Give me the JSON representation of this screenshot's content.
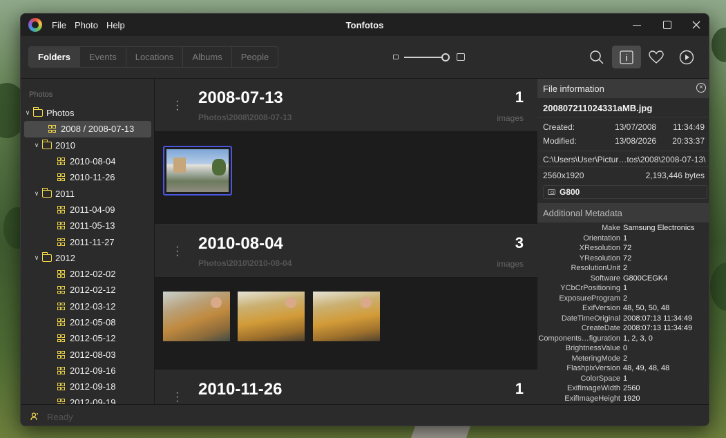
{
  "window": {
    "title": "Tonfotos",
    "menu": [
      "File",
      "Photo",
      "Help"
    ]
  },
  "toolbar": {
    "tabs": [
      "Folders",
      "Events",
      "Locations",
      "Albums",
      "People"
    ],
    "active_tab": "Folders",
    "zoom_level": 0.85
  },
  "sidebar": {
    "header": "Photos",
    "tree": [
      {
        "label": "Photos",
        "depth": 0,
        "type": "folder",
        "expanded": true
      },
      {
        "label": "2008 / 2008-07-13",
        "depth": 1,
        "type": "album",
        "selected": true
      },
      {
        "label": "2010",
        "depth": 1,
        "type": "folder",
        "expanded": true
      },
      {
        "label": "2010-08-04",
        "depth": 2,
        "type": "album"
      },
      {
        "label": "2010-11-26",
        "depth": 2,
        "type": "album"
      },
      {
        "label": "2011",
        "depth": 1,
        "type": "folder",
        "expanded": true
      },
      {
        "label": "2011-04-09",
        "depth": 2,
        "type": "album"
      },
      {
        "label": "2011-05-13",
        "depth": 2,
        "type": "album"
      },
      {
        "label": "2011-11-27",
        "depth": 2,
        "type": "album"
      },
      {
        "label": "2012",
        "depth": 1,
        "type": "folder",
        "expanded": true
      },
      {
        "label": "2012-02-02",
        "depth": 2,
        "type": "album"
      },
      {
        "label": "2012-02-12",
        "depth": 2,
        "type": "album"
      },
      {
        "label": "2012-03-12",
        "depth": 2,
        "type": "album"
      },
      {
        "label": "2012-05-08",
        "depth": 2,
        "type": "album"
      },
      {
        "label": "2012-05-12",
        "depth": 2,
        "type": "album"
      },
      {
        "label": "2012-08-03",
        "depth": 2,
        "type": "album"
      },
      {
        "label": "2012-09-16",
        "depth": 2,
        "type": "album"
      },
      {
        "label": "2012-09-18",
        "depth": 2,
        "type": "album"
      },
      {
        "label": "2012-09-19",
        "depth": 2,
        "type": "album"
      }
    ]
  },
  "main": {
    "groups": [
      {
        "title": "2008-07-13",
        "path": "Photos\\2008\\2008-07-13",
        "count": "1",
        "unit": "images"
      },
      {
        "title": "2010-08-04",
        "path": "Photos\\2010\\2010-08-04",
        "count": "3",
        "unit": "images"
      },
      {
        "title": "2010-11-26",
        "path": "",
        "count": "1",
        "unit": ""
      }
    ]
  },
  "info": {
    "header": "File information",
    "filename": "200807211024331aMB.jpg",
    "created_label": "Created:",
    "created_date": "13/07/2008",
    "created_time": "11:34:49",
    "modified_label": "Modified:",
    "modified_date": "13/08/2026",
    "modified_time": "20:33:37",
    "path": "C:\\Users\\User\\Pictur…tos\\2008\\2008-07-13\\",
    "resolution": "2560x1920",
    "size": "2,193,446 bytes",
    "camera": "G800",
    "meta_header": "Additional Metadata",
    "metadata": [
      {
        "key": "Make",
        "value": "Samsung Electronics"
      },
      {
        "key": "Orientation",
        "value": "1"
      },
      {
        "key": "XResolution",
        "value": "72"
      },
      {
        "key": "YResolution",
        "value": "72"
      },
      {
        "key": "ResolutionUnit",
        "value": "2"
      },
      {
        "key": "Software",
        "value": "G800CEGK4"
      },
      {
        "key": "YCbCrPositioning",
        "value": "1"
      },
      {
        "key": "ExposureProgram",
        "value": "2"
      },
      {
        "key": "ExifVersion",
        "value": "48, 50, 50, 48"
      },
      {
        "key": "DateTimeOriginal",
        "value": "2008:07:13 11:34:49"
      },
      {
        "key": "CreateDate",
        "value": "2008:07:13 11:34:49"
      },
      {
        "key": "Components…figuration",
        "value": "1, 2, 3, 0"
      },
      {
        "key": "BrightnessValue",
        "value": "0"
      },
      {
        "key": "MeteringMode",
        "value": "2"
      },
      {
        "key": "FlashpixVersion",
        "value": "48, 49, 48, 48"
      },
      {
        "key": "ColorSpace",
        "value": "1"
      },
      {
        "key": "ExifImageWidth",
        "value": "2560"
      },
      {
        "key": "ExifImageHeight",
        "value": "1920"
      }
    ]
  },
  "status": {
    "text": "Ready"
  }
}
